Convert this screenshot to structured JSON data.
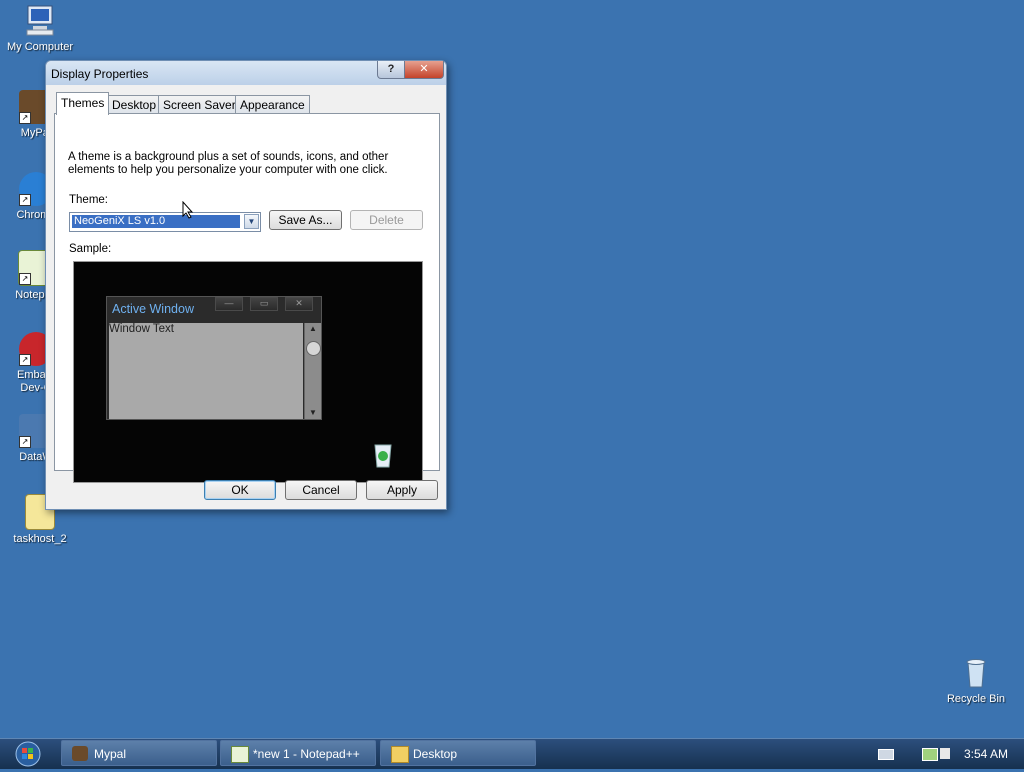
{
  "desktop": {
    "icons": [
      {
        "label": "My Computer"
      },
      {
        "label": "MyPal"
      },
      {
        "label": "Chrome"
      },
      {
        "label": "Notepad"
      },
      {
        "label": "Embarc Dev-C"
      },
      {
        "label": "DataW"
      },
      {
        "label": "taskhost_2"
      },
      {
        "label": "Recycle Bin"
      }
    ]
  },
  "dialog": {
    "title": "Display Properties",
    "help_glyph": "?",
    "close_glyph": "✕",
    "tabs": [
      {
        "label": "Themes"
      },
      {
        "label": "Desktop"
      },
      {
        "label": "Screen Saver"
      },
      {
        "label": "Appearance"
      }
    ],
    "description": "A theme is a background plus a set of sounds, icons, and other elements to help you personalize your computer with one click.",
    "theme_label": "Theme:",
    "theme_value": "NeoGeniX LS v1.0",
    "save_as": "Save As...",
    "delete": "Delete",
    "sample_label": "Sample:",
    "sample": {
      "window_title": "Active Window",
      "window_text": "Window Text"
    },
    "ok": "OK",
    "cancel": "Cancel",
    "apply": "Apply"
  },
  "taskbar": {
    "tasks": [
      {
        "label": "Mypal"
      },
      {
        "label": "*new 1 - Notepad++"
      },
      {
        "label": "Desktop"
      }
    ],
    "clock": "3:54 AM"
  },
  "colors": {
    "desktop": "#3b73b0",
    "selection": "#3a6fc4",
    "close_button": "#c4432a"
  }
}
